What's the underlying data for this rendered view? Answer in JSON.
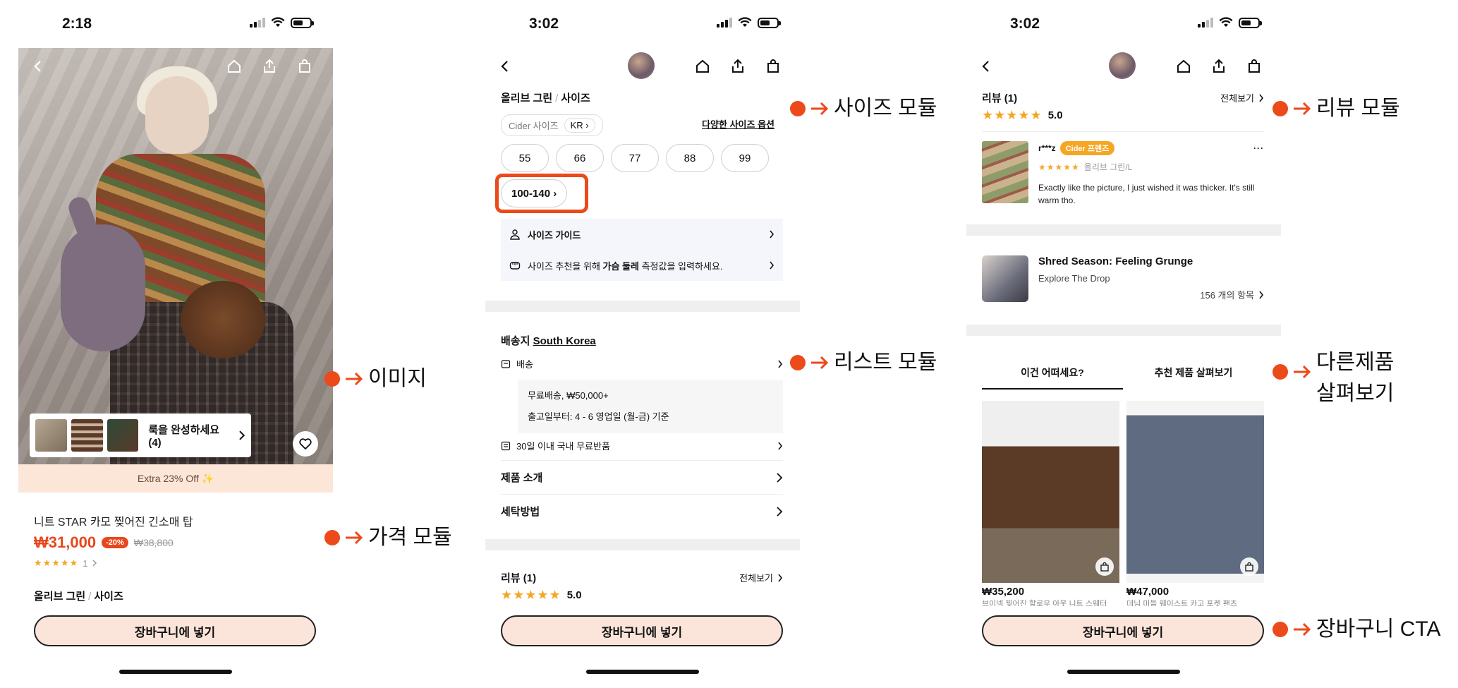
{
  "screens": [
    {
      "status": {
        "time": "2:18"
      },
      "look": {
        "label": "룩을 완성하세요(4)"
      },
      "promo": "Extra 23% Off ✨",
      "product": {
        "name": "니트 STAR 카모 찢어진 긴소매 탑",
        "price": "₩31,000",
        "discount": "-20%",
        "original_price": "₩38,800",
        "rating_count": "1"
      },
      "variant": {
        "color": "올리브 그린",
        "sep": "/",
        "size": "사이즈"
      },
      "cta": "장바구니에 넣기"
    },
    {
      "status": {
        "time": "3:02"
      },
      "variant": {
        "color": "올리브 그린",
        "sep": "/",
        "size": "사이즈"
      },
      "size_system": {
        "label": "Cider 사이즈",
        "region": "KR"
      },
      "more_sizes": "다양한 사이즈 옵션",
      "sizes": [
        "55",
        "66",
        "77",
        "88",
        "99"
      ],
      "size_extra": "100-140",
      "size_guide": "사이즈 가이드",
      "recommend": {
        "pre": "사이즈 추천을 위해 ",
        "bold": "가슴 둘레",
        "post": " 측정값을 입력하세요."
      },
      "shipping": {
        "label": "배송지",
        "country": "South Korea",
        "delivery": "배송",
        "free": "무료배송, ₩50,000+",
        "eta": "출고일부터: 4 - 6 영업일 (월-금) 기준",
        "returns": "30일 이내 국내 무료반품"
      },
      "menu": [
        "제품 소개",
        "세탁방법"
      ],
      "review": {
        "title": "리뷰 (1)",
        "all": "전체보기",
        "score": "5.0"
      },
      "cta": "장바구니에 넣기"
    },
    {
      "status": {
        "time": "3:02"
      },
      "review": {
        "title": "리뷰 (1)",
        "all": "전체보기",
        "score": "5.0",
        "user": "r***z",
        "badge": "Cider 프렌즈",
        "more": "···",
        "variant": "올리브 그린/L",
        "text": "Exactly like the picture, I just wished it was thicker. It's still warm tho."
      },
      "drop": {
        "title": "Shred Season: Feeling Grunge",
        "subtitle": "Explore The Drop",
        "count": "156 개의 항목"
      },
      "tabs": [
        "이건 어떠세요?",
        "추천 제품 살펴보기"
      ],
      "products": [
        {
          "price": "₩35,200",
          "name": "브이넥 찢어진 할로우 아웃 니트 스웨터"
        },
        {
          "price": "₩47,000",
          "name": "데님 미들 웨이스트 카고 포켓 팬츠"
        }
      ],
      "cta": "장바구니에 넣기"
    }
  ],
  "annotations": {
    "image": "이미지",
    "price": "가격 모듈",
    "size": "사이즈 모듈",
    "list": "리스트 모듈",
    "review": "리뷰 모듈",
    "other_1": "다른제품",
    "other_2": "살펴보기",
    "cart": "장바구니 CTA"
  },
  "colors": {
    "accent": "#ec4a1a",
    "price": "#e8471c",
    "star": "#f5a623",
    "cta_bg": "#fbe4d9",
    "promo_bg": "#fbe6d8"
  },
  "icons": [
    "back-icon",
    "home-icon",
    "share-icon",
    "bag-icon",
    "heart-icon",
    "chevron-right-icon",
    "person-icon",
    "ruler-icon",
    "truck-icon",
    "return-icon",
    "arrow-right-icon"
  ]
}
